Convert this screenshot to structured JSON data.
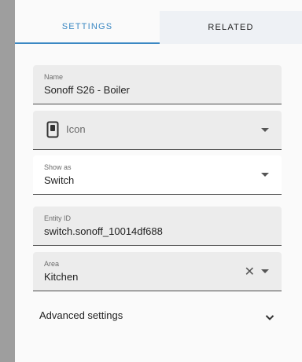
{
  "tabs": [
    {
      "label": "SETTINGS",
      "active": true
    },
    {
      "label": "RELATED",
      "active": false
    }
  ],
  "fields": {
    "name": {
      "label": "Name",
      "value": "Sonoff S26 - Boiler"
    },
    "icon": {
      "placeholder": "Icon",
      "icon": "switch-outlet-icon"
    },
    "show_as": {
      "label": "Show as",
      "value": "Switch"
    },
    "entity_id": {
      "label": "Entity ID",
      "value": "switch.sonoff_10014df688"
    },
    "area": {
      "label": "Area",
      "value": "Kitchen"
    }
  },
  "advanced": {
    "label": "Advanced settings"
  },
  "colors": {
    "accent": "#3b88c3",
    "field_bg": "#ececec",
    "dialog_bg": "#fafafa"
  }
}
